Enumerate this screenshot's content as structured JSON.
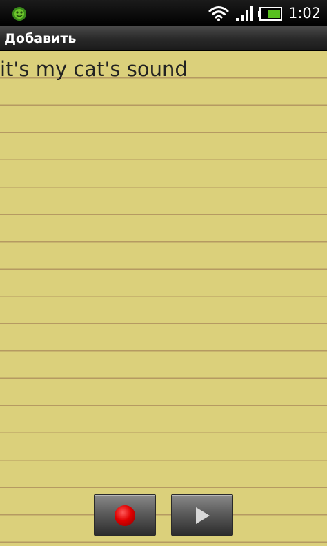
{
  "status_bar": {
    "time": "1:02",
    "icons": [
      "app-notification-icon",
      "wifi-icon",
      "signal-icon",
      "battery-icon"
    ],
    "battery_color": "#58c01e"
  },
  "title_bar": {
    "title": "Добавить"
  },
  "note": {
    "text": "it's my cat's sound",
    "paper_color": "#dbd07b",
    "line_color": "#b59a62"
  },
  "controls": {
    "buttons": [
      {
        "name": "record",
        "icon": "record-icon",
        "icon_color": "#e00000"
      },
      {
        "name": "play",
        "icon": "play-icon",
        "icon_color": "#d8d8d8"
      }
    ]
  }
}
